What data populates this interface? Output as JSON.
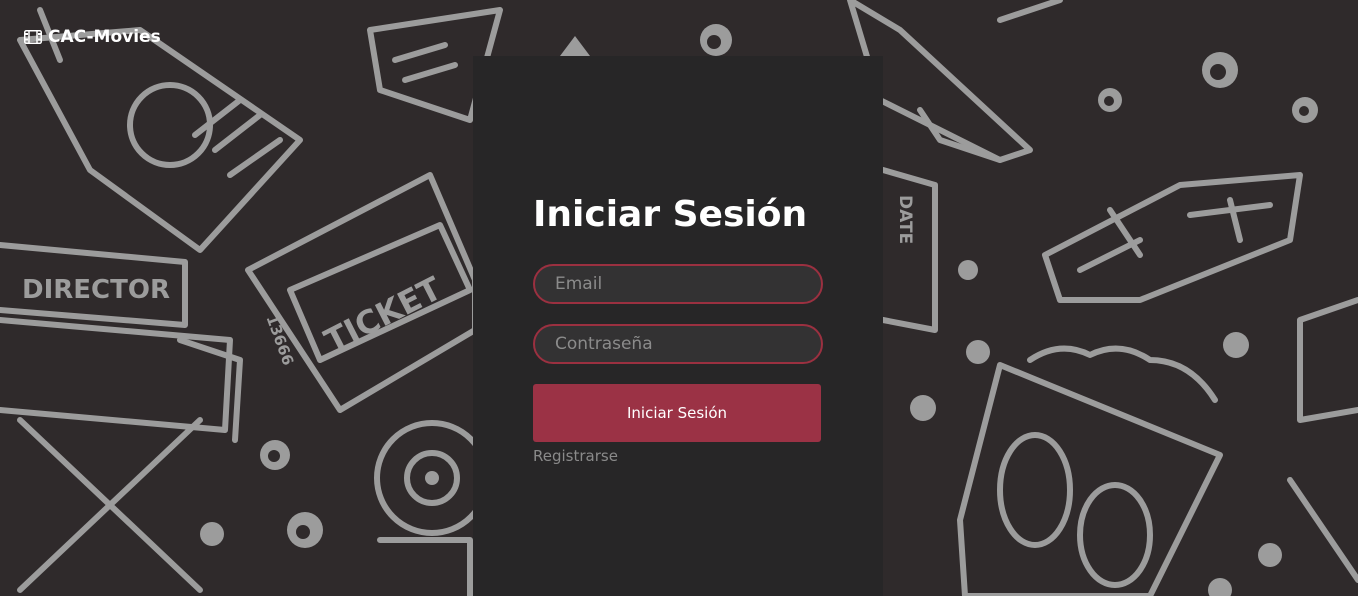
{
  "brand": {
    "icon": "film-icon",
    "name": "CAC-Movies"
  },
  "background": {
    "texts": {
      "director": "DIRECTOR",
      "ticket": "TICKET",
      "ticket_number": "13666",
      "date": "DATE"
    }
  },
  "login": {
    "title": "Iniciar Sesión",
    "email_placeholder": "Email",
    "password_placeholder": "Contraseña",
    "submit_label": "Iniciar Sesión",
    "register_link": "Registrarse"
  },
  "colors": {
    "background": "#2f2a2b",
    "panel": "#272627",
    "accent": "#9b3245",
    "artwork": "#9c9c9c"
  }
}
